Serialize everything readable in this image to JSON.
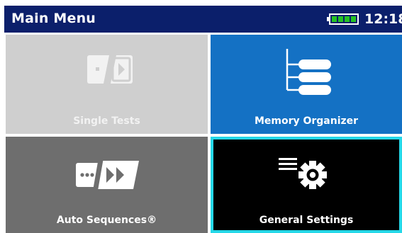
{
  "header": {
    "title": "Main Menu",
    "time": "12:18",
    "battery_icon": "battery-full-icon",
    "battery_cells": 4,
    "background": "#0b1f6b",
    "battery_color": "#24c222"
  },
  "tiles": [
    {
      "label": "Single Tests",
      "icon": "single-test-icon",
      "background": "#cfcfcf",
      "selected": false
    },
    {
      "label": "Memory Organizer",
      "icon": "tree-database-icon",
      "background": "#1471c4",
      "selected": false
    },
    {
      "label": "Auto Sequences®",
      "icon": "auto-sequence-icon",
      "background": "#6e6e6e",
      "selected": false
    },
    {
      "label": "General Settings",
      "icon": "settings-gear-icon",
      "background": "#000000",
      "selected": true,
      "highlight": "#25d8e8"
    }
  ]
}
